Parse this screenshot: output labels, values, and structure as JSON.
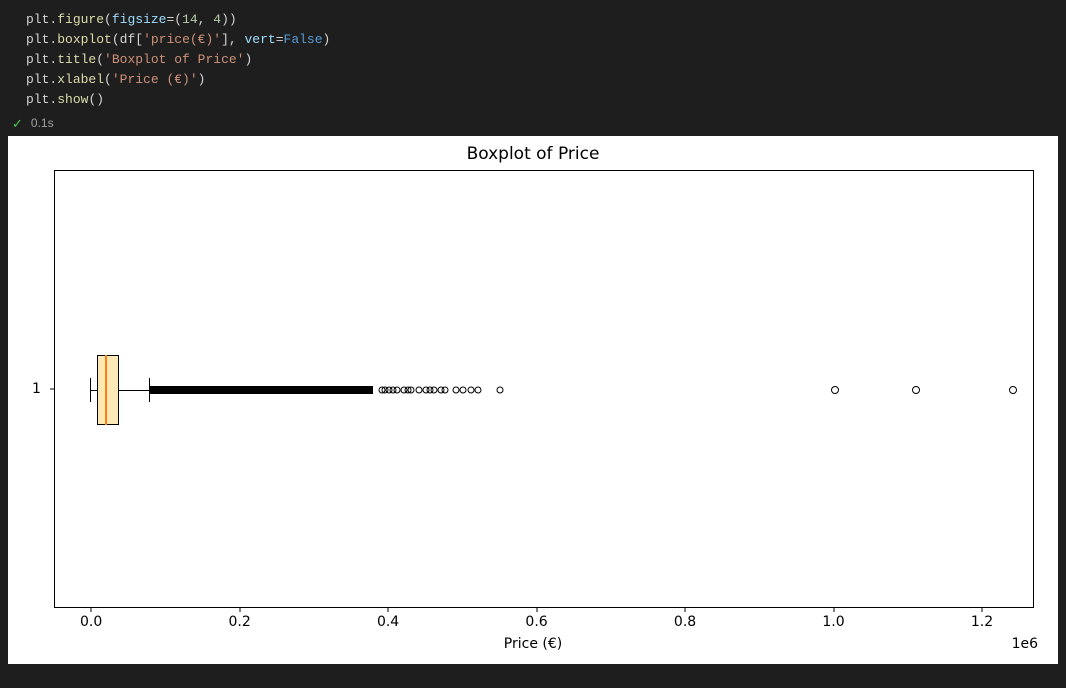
{
  "code": {
    "l1": {
      "obj": "plt",
      "func": "figure",
      "param": "figsize",
      "n1": "14",
      "n2": "4"
    },
    "l2": {
      "obj": "plt",
      "func": "boxplot",
      "arg_obj": "df",
      "arg_key": "'price(€)'",
      "param": "vert",
      "const": "False"
    },
    "l3": {
      "obj": "plt",
      "func": "title",
      "str": "'Boxplot of Price'"
    },
    "l4": {
      "obj": "plt",
      "func": "xlabel",
      "str": "'Price (€)'"
    },
    "l5": {
      "obj": "plt",
      "func": "show"
    }
  },
  "status": {
    "icon": "✓",
    "duration": "0.1s"
  },
  "plot": {
    "title": "Boxplot of Price",
    "xlabel": "Price (€)",
    "offset": "1e6",
    "ylabels": [
      "1"
    ],
    "xticks": [
      "0.0",
      "0.2",
      "0.4",
      "0.6",
      "0.8",
      "1.0",
      "1.2"
    ]
  },
  "chart_data": {
    "type": "boxplot",
    "orientation": "horizontal",
    "title": "Boxplot of Price",
    "xlabel": "Price (€)",
    "x_scale_multiplier": 1000000,
    "x_scale_label": "1e6",
    "xlim": [
      -0.05,
      1.27
    ],
    "categories": [
      "1"
    ],
    "box": {
      "whisker_low": 0.0,
      "q1": 0.01,
      "median": 0.02,
      "q3": 0.04,
      "whisker_high": 0.08
    },
    "outliers_note": "Very dense cluster of outliers from ~0.08 to ~0.45, sparser individual outliers beyond",
    "outliers_dense_range": [
      0.08,
      0.38
    ],
    "outliers_sparse": [
      0.39,
      0.395,
      0.4,
      0.405,
      0.41,
      0.42,
      0.425,
      0.43,
      0.44,
      0.45,
      0.455,
      0.46,
      0.47,
      0.475,
      0.49,
      0.5,
      0.51,
      0.52,
      0.55,
      1.0,
      1.11,
      1.24
    ]
  }
}
